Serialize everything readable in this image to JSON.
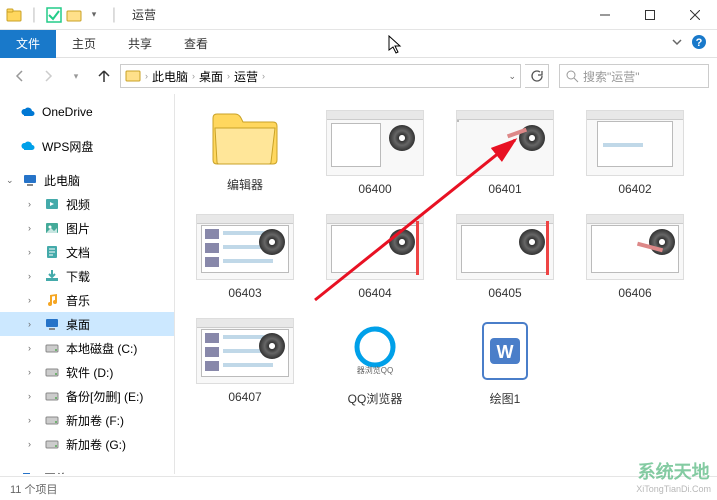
{
  "window": {
    "title": "运营"
  },
  "ribbon": {
    "file": "文件",
    "tabs": [
      "主页",
      "共享",
      "查看"
    ]
  },
  "nav": {
    "breadcrumb": [
      "此电脑",
      "桌面",
      "运营"
    ],
    "search_placeholder": "搜索\"运营\""
  },
  "tree": {
    "onedrive": "OneDrive",
    "wps": "WPS网盘",
    "thispc": "此电脑",
    "children": [
      {
        "label": "视频",
        "icon": "video"
      },
      {
        "label": "图片",
        "icon": "pictures"
      },
      {
        "label": "文档",
        "icon": "documents"
      },
      {
        "label": "下载",
        "icon": "downloads"
      },
      {
        "label": "音乐",
        "icon": "music"
      },
      {
        "label": "桌面",
        "icon": "desktop",
        "selected": true
      },
      {
        "label": "本地磁盘 (C:)",
        "icon": "drive"
      },
      {
        "label": "软件 (D:)",
        "icon": "drive"
      },
      {
        "label": "备份[勿删] (E:)",
        "icon": "drive"
      },
      {
        "label": "新加卷 (F:)",
        "icon": "drive"
      },
      {
        "label": "新加卷 (G:)",
        "icon": "drive"
      }
    ],
    "network": "网络"
  },
  "items": [
    {
      "name": "编辑器",
      "kind": "folder"
    },
    {
      "name": "06400",
      "kind": "image",
      "variant": "t0"
    },
    {
      "name": "06401",
      "kind": "image",
      "variant": "t1"
    },
    {
      "name": "06402",
      "kind": "image",
      "variant": "t2"
    },
    {
      "name": "06403",
      "kind": "image",
      "variant": "t3"
    },
    {
      "name": "06404",
      "kind": "image",
      "variant": "t4"
    },
    {
      "name": "06405",
      "kind": "image",
      "variant": "t4"
    },
    {
      "name": "06406",
      "kind": "image",
      "variant": "t5"
    },
    {
      "name": "06407",
      "kind": "image",
      "variant": "t3"
    },
    {
      "name": "QQ浏览器",
      "kind": "app"
    },
    {
      "name": "绘图1",
      "kind": "doc"
    }
  ],
  "status": {
    "text": "11 个项目"
  },
  "watermark": {
    "zh": "系统天地",
    "en": "XiTongTianDi.Com"
  },
  "colors": {
    "accent": "#1979ca"
  }
}
